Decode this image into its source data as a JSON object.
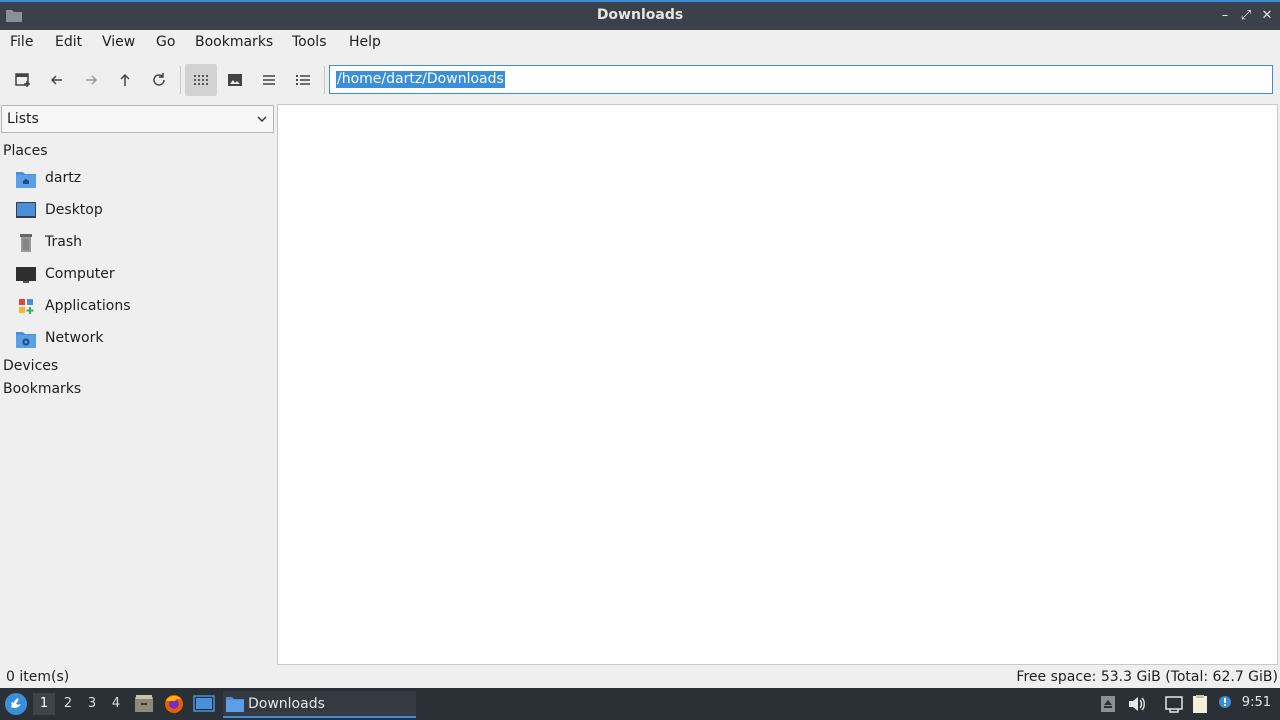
{
  "window": {
    "title": "Downloads"
  },
  "menubar": {
    "items": [
      "File",
      "Edit",
      "View",
      "Go",
      "Bookmarks",
      "Tools",
      "Help"
    ]
  },
  "toolbar": {
    "buttons": [
      "new-tab-icon",
      "back-icon",
      "forward-icon",
      "up-icon",
      "reload-icon",
      "icon-view-icon",
      "thumbnail-view-icon",
      "compact-view-icon",
      "detailed-list-view-icon"
    ],
    "active_view": "icon-view"
  },
  "location": {
    "path": "/home/dartz/Downloads"
  },
  "sidebar": {
    "mode": "Lists",
    "sections": {
      "places": "Places",
      "devices": "Devices",
      "bookmarks": "Bookmarks"
    },
    "places": [
      {
        "label": "dartz",
        "icon": "home-folder-icon"
      },
      {
        "label": "Desktop",
        "icon": "desktop-icon"
      },
      {
        "label": "Trash",
        "icon": "trash-icon"
      },
      {
        "label": "Computer",
        "icon": "computer-icon"
      },
      {
        "label": "Applications",
        "icon": "applications-icon"
      },
      {
        "label": "Network",
        "icon": "network-folder-icon"
      }
    ]
  },
  "status": {
    "items": "0 item(s)",
    "free_space": "Free space: 53.3 GiB (Total: 62.7 GiB)"
  },
  "taskbar": {
    "workspaces": [
      "1",
      "2",
      "3",
      "4"
    ],
    "active_workspace": "1",
    "task_label": "Downloads",
    "clock": "9:51"
  },
  "colors": {
    "accent": "#3b8ed8",
    "titlebar": "#3b4049",
    "taskbar": "#2b2f36",
    "folder": "#4a90d9"
  }
}
